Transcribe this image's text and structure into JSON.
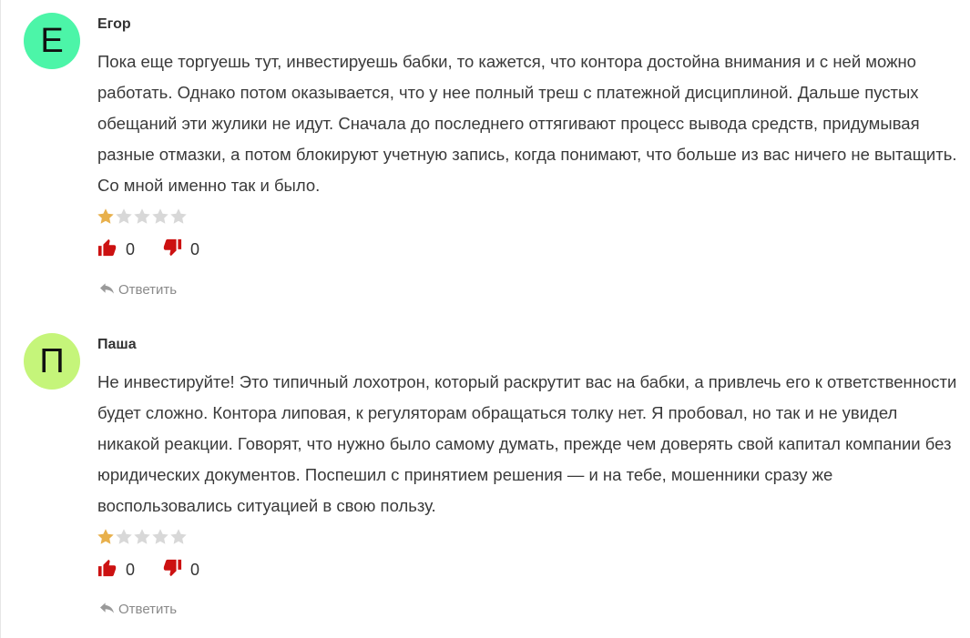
{
  "colors": {
    "star_filled": "#e8b04b",
    "star_empty": "#d8d8d8",
    "thumb_up": "#cc1111",
    "thumb_down": "#cc1111",
    "reply": "#8a8a8a"
  },
  "comments": [
    {
      "avatar_letter": "Е",
      "avatar_color": "#4cf5a8",
      "author": "Егор",
      "text": "Пока еще торгуешь тут, инвестируешь бабки, то кажется, что контора достойна внимания и с ней можно работать. Однако потом оказывается, что у нее полный треш с платежной дисциплиной. Дальше пустых обещаний эти жулики не идут. Сначала до последнего оттягивают процесс вывода средств, придумывая разные отмазки, а потом блокируют учетную запись, когда понимают, что больше из вас ничего не вытащить. Со мной именно так и было.",
      "rating": 1,
      "rating_max": 5,
      "likes": "0",
      "dislikes": "0",
      "reply_label": "Ответить"
    },
    {
      "avatar_letter": "П",
      "avatar_color": "#c5f57a",
      "author": "Паша",
      "text": "Не инвестируйте! Это типичный лохотрон, который раскрутит вас на бабки, а привлечь его к ответственности будет сложно. Контора липовая, к регуляторам обращаться толку нет. Я пробовал, но так и не увидел никакой реакции. Говорят, что нужно было самому думать, прежде чем доверять свой капитал компании без юридических документов. Поспешил с принятием решения — и на тебе, мошенники сразу же воспользовались ситуацией в свою пользу.",
      "rating": 1,
      "rating_max": 5,
      "likes": "0",
      "dislikes": "0",
      "reply_label": "Ответить"
    }
  ]
}
